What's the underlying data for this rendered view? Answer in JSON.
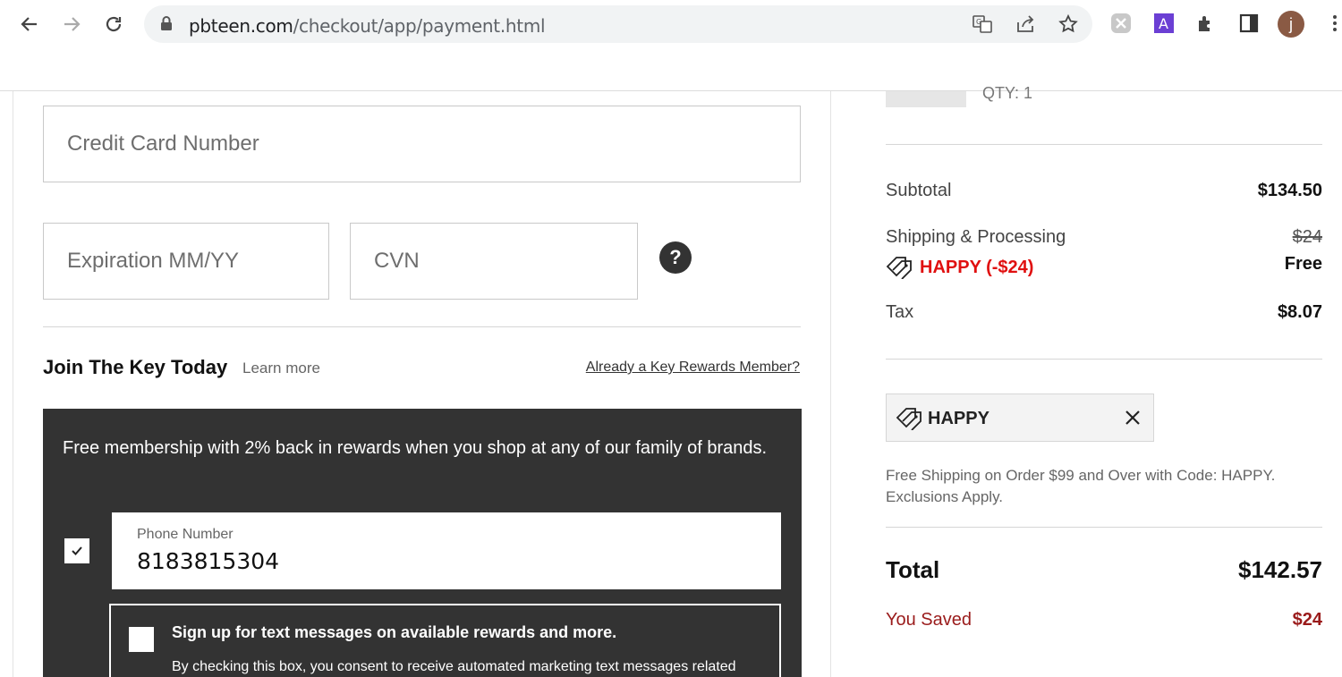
{
  "browser": {
    "url_host": "pbteen.com",
    "url_path": "/checkout/app/payment.html",
    "avatar_letter": "j"
  },
  "payment": {
    "card_placeholder": "Credit Card Number",
    "expiration_placeholder": "Expiration MM/YY",
    "cvn_placeholder": "CVN",
    "help_label": "?"
  },
  "rewards": {
    "title": "Join The Key Today",
    "learn_more": "Learn more",
    "already_member": "Already a Key Rewards Member?",
    "promo_text": "Free membership with 2% back in rewards when you shop at any of our family of brands.",
    "phone_label": "Phone Number",
    "phone_value": "8183815304",
    "phone_checked": true,
    "sms_title": "Sign up for text messages on available rewards and more.",
    "sms_body": "By checking this box, you consent to receive automated marketing text messages related",
    "sms_checked": false
  },
  "summary": {
    "qty": "QTY: 1",
    "subtotal_label": "Subtotal",
    "subtotal_value": "$134.50",
    "shipping_label": "Shipping & Processing",
    "shipping_original": "$24",
    "shipping_promo": "HAPPY (-$24)",
    "shipping_final": "Free",
    "tax_label": "Tax",
    "tax_value": "$8.07",
    "promo_code": "HAPPY",
    "promo_note": "Free Shipping on Order $99 and Over with Code: HAPPY. Exclusions Apply.",
    "total_label": "Total",
    "total_value": "$142.57",
    "saved_label": "You Saved",
    "saved_value": "$24"
  },
  "colors": {
    "promo_red": "#e01010",
    "saved_red": "#9a1b1b",
    "dark_panel": "#333333"
  }
}
